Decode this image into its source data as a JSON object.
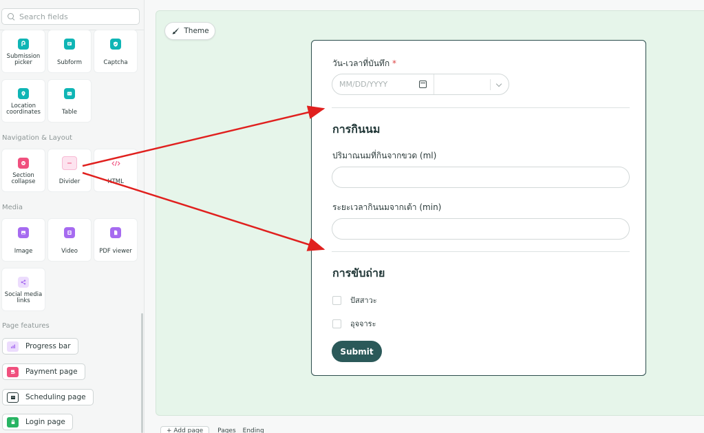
{
  "sidebar": {
    "search_placeholder": "Search fields",
    "tiles_top": [
      {
        "label": "Submission picker"
      },
      {
        "label": "Subform"
      },
      {
        "label": "Captcha"
      },
      {
        "label": "Location coordinates"
      },
      {
        "label": "Table"
      }
    ],
    "nav_layout_title": "Navigation & Layout",
    "nav_tiles": [
      {
        "label": "Section collapse"
      },
      {
        "label": "Divider"
      },
      {
        "label": "HTML"
      }
    ],
    "media_title": "Media",
    "media_tiles": [
      {
        "label": "Image"
      },
      {
        "label": "Video"
      },
      {
        "label": "PDF viewer"
      },
      {
        "label": "Social media links"
      }
    ],
    "page_features_title": "Page features",
    "page_features": [
      {
        "label": "Progress bar"
      },
      {
        "label": "Payment page"
      },
      {
        "label": "Scheduling page"
      },
      {
        "label": "Login page"
      }
    ]
  },
  "canvas": {
    "theme_label": "Theme"
  },
  "form": {
    "date_label": "วัน-เวลาที่บันทึก",
    "required_mark": "*",
    "date_placeholder": "MM/DD/YYYY",
    "section_feeding": "การกินนม",
    "bottle_label": "ปริมาณนมที่กินจากขวด (ml)",
    "breast_label": "ระยะเวลากินนมจากเต้า (min)",
    "section_excretion": "การขับถ่าย",
    "checkbox_urine": "ปัสสาวะ",
    "checkbox_stool": "อุจจาระ",
    "submit_label": "Submit"
  },
  "bottom_bar": {
    "add_page": "+ Add page",
    "pages": "Pages",
    "ending": "Ending"
  },
  "colors": {
    "accent": "#2b5959",
    "canvas_bg": "#e6f5ea",
    "arrow": "#e0201e"
  }
}
